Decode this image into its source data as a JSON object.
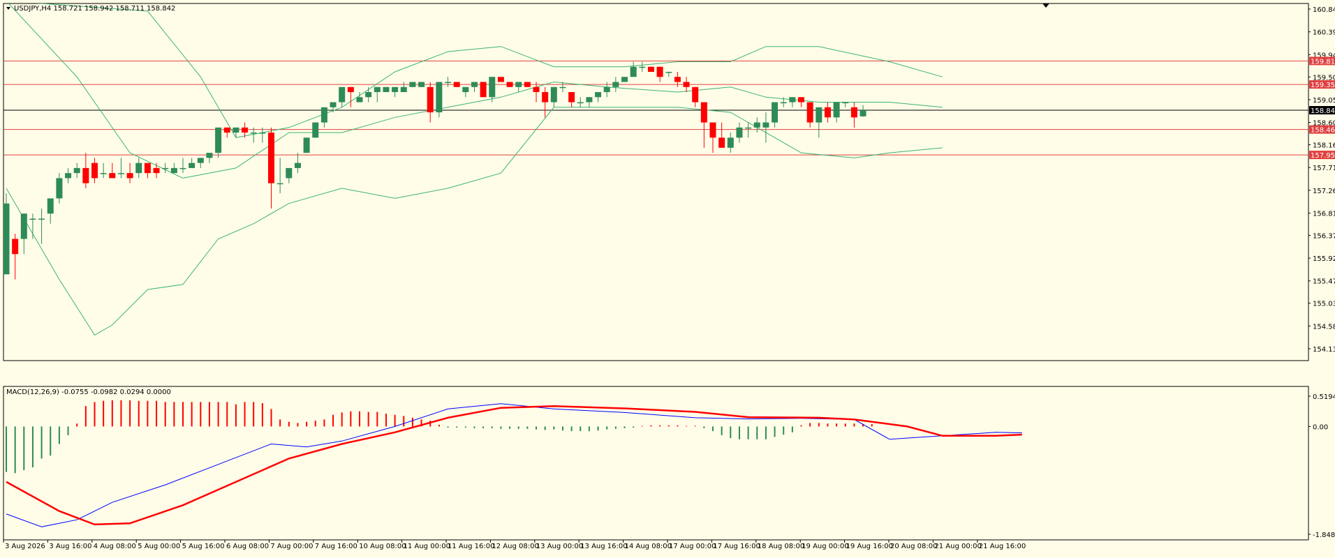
{
  "symbol_header": "USDJPY,H4  158.721 158.942 158.711 158.842",
  "macd_header": "MACD(12,26,9) -0.0755 -0.0982 0.0294 0.0000",
  "colors": {
    "background": "#fffde8",
    "bull": "#2e8b57",
    "bear": "#ff0000",
    "band": "#3cb371",
    "level_line": "#e04040",
    "current_price": "#000000",
    "macd_main": "#0000ff",
    "macd_signal": "#ff0000"
  },
  "price_axis": {
    "min": 154.13,
    "max": 160.84,
    "ticks": [
      "160.840",
      "160.390",
      "159.940",
      "159.500",
      "159.050",
      "158.600",
      "158.160",
      "157.710",
      "157.260",
      "156.810",
      "156.370",
      "155.920",
      "155.470",
      "155.030",
      "154.580",
      "154.130"
    ]
  },
  "level_labels": [
    {
      "value": 159.815,
      "label": "159.815"
    },
    {
      "value": 159.351,
      "label": "159.351"
    },
    {
      "value": 158.461,
      "label": "158.461"
    },
    {
      "value": 157.959,
      "label": "157.959"
    }
  ],
  "current_price": {
    "value": 158.842,
    "label": "158.842"
  },
  "macd_axis": {
    "min": -1.8482,
    "max": 0.5194,
    "ticks": [
      "0.5194",
      "0.00",
      "-1.8482"
    ]
  },
  "time_labels": [
    "3 Aug 2026",
    "3 Aug 16:00",
    "4 Aug 08:00",
    "5 Aug 00:00",
    "5 Aug 16:00",
    "6 Aug 08:00",
    "7 Aug 00:00",
    "7 Aug 16:00",
    "10 Aug 08:00",
    "11 Aug 00:00",
    "11 Aug 16:00",
    "12 Aug 08:00",
    "13 Aug 00:00",
    "13 Aug 16:00",
    "14 Aug 08:00",
    "17 Aug 00:00",
    "17 Aug 16:00",
    "18 Aug 08:00",
    "19 Aug 00:00",
    "19 Aug 16:00",
    "20 Aug 08:00",
    "21 Aug 00:00",
    "21 Aug 16:00"
  ],
  "chart_data": {
    "type": "candlestick",
    "symbol": "USDJPY",
    "timeframe": "H4",
    "candles": [
      {
        "o": 155.6,
        "h": 157.2,
        "l": 155.6,
        "c": 157.0
      },
      {
        "o": 156.3,
        "h": 156.4,
        "l": 155.5,
        "c": 156.0
      },
      {
        "o": 156.3,
        "h": 156.8,
        "l": 156.0,
        "c": 156.8
      },
      {
        "o": 156.7,
        "h": 156.8,
        "l": 156.3,
        "c": 156.7
      },
      {
        "o": 156.7,
        "h": 156.9,
        "l": 156.2,
        "c": 156.7
      },
      {
        "o": 156.8,
        "h": 157.1,
        "l": 156.6,
        "c": 157.1
      },
      {
        "o": 157.1,
        "h": 157.6,
        "l": 157.0,
        "c": 157.5
      },
      {
        "o": 157.5,
        "h": 157.7,
        "l": 157.4,
        "c": 157.6
      },
      {
        "o": 157.6,
        "h": 157.8,
        "l": 157.5,
        "c": 157.7
      },
      {
        "o": 157.7,
        "h": 158.0,
        "l": 157.3,
        "c": 157.4
      },
      {
        "o": 157.8,
        "h": 157.9,
        "l": 157.4,
        "c": 157.5
      },
      {
        "o": 157.6,
        "h": 157.8,
        "l": 157.5,
        "c": 157.6
      },
      {
        "o": 157.6,
        "h": 157.8,
        "l": 157.5,
        "c": 157.5
      },
      {
        "o": 157.6,
        "h": 157.9,
        "l": 157.5,
        "c": 157.6
      },
      {
        "o": 157.6,
        "h": 157.8,
        "l": 157.4,
        "c": 157.5
      },
      {
        "o": 157.6,
        "h": 157.9,
        "l": 157.5,
        "c": 157.8
      },
      {
        "o": 157.8,
        "h": 157.8,
        "l": 157.5,
        "c": 157.6
      },
      {
        "o": 157.7,
        "h": 157.8,
        "l": 157.5,
        "c": 157.6
      },
      {
        "o": 157.7,
        "h": 157.8,
        "l": 157.6,
        "c": 157.7
      },
      {
        "o": 157.6,
        "h": 157.8,
        "l": 157.6,
        "c": 157.7
      },
      {
        "o": 157.7,
        "h": 157.9,
        "l": 157.6,
        "c": 157.7
      },
      {
        "o": 157.7,
        "h": 157.9,
        "l": 157.7,
        "c": 157.8
      },
      {
        "o": 157.8,
        "h": 157.9,
        "l": 157.7,
        "c": 157.9
      },
      {
        "o": 157.9,
        "h": 158.0,
        "l": 157.8,
        "c": 158.0
      },
      {
        "o": 158.0,
        "h": 158.5,
        "l": 157.9,
        "c": 158.5
      },
      {
        "o": 158.5,
        "h": 158.5,
        "l": 158.3,
        "c": 158.4
      },
      {
        "o": 158.4,
        "h": 158.5,
        "l": 158.3,
        "c": 158.5
      },
      {
        "o": 158.5,
        "h": 158.6,
        "l": 158.3,
        "c": 158.4
      },
      {
        "o": 158.4,
        "h": 158.5,
        "l": 158.2,
        "c": 158.4
      },
      {
        "o": 158.4,
        "h": 158.5,
        "l": 158.2,
        "c": 158.4
      },
      {
        "o": 158.4,
        "h": 158.5,
        "l": 156.9,
        "c": 157.4
      },
      {
        "o": 157.4,
        "h": 157.9,
        "l": 157.2,
        "c": 157.4
      },
      {
        "o": 157.5,
        "h": 157.7,
        "l": 157.4,
        "c": 157.7
      },
      {
        "o": 157.7,
        "h": 158.0,
        "l": 157.6,
        "c": 157.8
      },
      {
        "o": 158.0,
        "h": 158.3,
        "l": 158.0,
        "c": 158.3
      },
      {
        "o": 158.3,
        "h": 158.6,
        "l": 158.3,
        "c": 158.6
      },
      {
        "o": 158.6,
        "h": 158.9,
        "l": 158.5,
        "c": 158.9
      },
      {
        "o": 158.9,
        "h": 159.0,
        "l": 158.8,
        "c": 159.0
      },
      {
        "o": 159.0,
        "h": 159.3,
        "l": 158.9,
        "c": 159.3
      },
      {
        "o": 159.3,
        "h": 159.3,
        "l": 158.9,
        "c": 159.2
      },
      {
        "o": 159.0,
        "h": 159.2,
        "l": 159.0,
        "c": 159.1
      },
      {
        "o": 159.1,
        "h": 159.3,
        "l": 159.0,
        "c": 159.2
      },
      {
        "o": 159.2,
        "h": 159.3,
        "l": 159.0,
        "c": 159.3
      },
      {
        "o": 159.2,
        "h": 159.3,
        "l": 159.2,
        "c": 159.3
      },
      {
        "o": 159.2,
        "h": 159.3,
        "l": 159.1,
        "c": 159.3
      },
      {
        "o": 159.2,
        "h": 159.4,
        "l": 159.2,
        "c": 159.3
      },
      {
        "o": 159.3,
        "h": 159.4,
        "l": 159.3,
        "c": 159.4
      },
      {
        "o": 159.3,
        "h": 159.4,
        "l": 159.3,
        "c": 159.4
      },
      {
        "o": 159.3,
        "h": 159.4,
        "l": 158.6,
        "c": 158.8
      },
      {
        "o": 158.8,
        "h": 159.4,
        "l": 158.7,
        "c": 159.4
      },
      {
        "o": 159.4,
        "h": 159.5,
        "l": 159.3,
        "c": 159.4
      },
      {
        "o": 159.4,
        "h": 159.4,
        "l": 159.3,
        "c": 159.3
      },
      {
        "o": 159.2,
        "h": 159.3,
        "l": 159.1,
        "c": 159.3
      },
      {
        "o": 159.3,
        "h": 159.4,
        "l": 159.2,
        "c": 159.4
      },
      {
        "o": 159.4,
        "h": 159.4,
        "l": 159.1,
        "c": 159.1
      },
      {
        "o": 159.1,
        "h": 159.5,
        "l": 159.0,
        "c": 159.5
      },
      {
        "o": 159.5,
        "h": 159.5,
        "l": 159.4,
        "c": 159.4
      },
      {
        "o": 159.4,
        "h": 159.4,
        "l": 159.3,
        "c": 159.3
      },
      {
        "o": 159.3,
        "h": 159.4,
        "l": 159.2,
        "c": 159.4
      },
      {
        "o": 159.4,
        "h": 159.4,
        "l": 159.3,
        "c": 159.3
      },
      {
        "o": 159.3,
        "h": 159.4,
        "l": 159.0,
        "c": 159.2
      },
      {
        "o": 159.2,
        "h": 159.3,
        "l": 158.7,
        "c": 159.0
      },
      {
        "o": 159.0,
        "h": 159.3,
        "l": 158.9,
        "c": 159.3
      },
      {
        "o": 159.3,
        "h": 159.4,
        "l": 159.2,
        "c": 159.3
      },
      {
        "o": 159.2,
        "h": 159.2,
        "l": 158.9,
        "c": 159.0
      },
      {
        "o": 159.0,
        "h": 159.1,
        "l": 158.9,
        "c": 159.0
      },
      {
        "o": 159.0,
        "h": 159.1,
        "l": 158.9,
        "c": 159.1
      },
      {
        "o": 159.1,
        "h": 159.2,
        "l": 159.0,
        "c": 159.2
      },
      {
        "o": 159.2,
        "h": 159.4,
        "l": 159.1,
        "c": 159.3
      },
      {
        "o": 159.3,
        "h": 159.5,
        "l": 159.2,
        "c": 159.4
      },
      {
        "o": 159.4,
        "h": 159.5,
        "l": 159.4,
        "c": 159.5
      },
      {
        "o": 159.5,
        "h": 159.8,
        "l": 159.5,
        "c": 159.7
      },
      {
        "o": 159.7,
        "h": 159.8,
        "l": 159.6,
        "c": 159.7
      },
      {
        "o": 159.7,
        "h": 159.7,
        "l": 159.6,
        "c": 159.6
      },
      {
        "o": 159.7,
        "h": 159.7,
        "l": 159.4,
        "c": 159.5
      },
      {
        "o": 159.6,
        "h": 159.6,
        "l": 159.5,
        "c": 159.6
      },
      {
        "o": 159.5,
        "h": 159.6,
        "l": 159.3,
        "c": 159.4
      },
      {
        "o": 159.4,
        "h": 159.5,
        "l": 159.2,
        "c": 159.3
      },
      {
        "o": 159.3,
        "h": 159.3,
        "l": 158.9,
        "c": 159.0
      },
      {
        "o": 159.0,
        "h": 159.0,
        "l": 158.1,
        "c": 158.6
      },
      {
        "o": 158.6,
        "h": 158.6,
        "l": 158.0,
        "c": 158.3
      },
      {
        "o": 158.3,
        "h": 158.6,
        "l": 158.1,
        "c": 158.1
      },
      {
        "o": 158.1,
        "h": 158.4,
        "l": 158.0,
        "c": 158.3
      },
      {
        "o": 158.3,
        "h": 158.6,
        "l": 158.2,
        "c": 158.5
      },
      {
        "o": 158.5,
        "h": 158.6,
        "l": 158.3,
        "c": 158.5
      },
      {
        "o": 158.5,
        "h": 158.7,
        "l": 158.4,
        "c": 158.6
      },
      {
        "o": 158.5,
        "h": 158.8,
        "l": 158.2,
        "c": 158.6
      },
      {
        "o": 158.6,
        "h": 159.0,
        "l": 158.5,
        "c": 159.0
      },
      {
        "o": 159.0,
        "h": 159.1,
        "l": 158.9,
        "c": 159.0
      },
      {
        "o": 159.0,
        "h": 159.1,
        "l": 158.9,
        "c": 159.1
      },
      {
        "o": 159.1,
        "h": 159.1,
        "l": 158.9,
        "c": 159.0
      },
      {
        "o": 159.0,
        "h": 159.0,
        "l": 158.5,
        "c": 158.6
      },
      {
        "o": 158.6,
        "h": 158.9,
        "l": 158.3,
        "c": 158.9
      },
      {
        "o": 158.9,
        "h": 159.0,
        "l": 158.6,
        "c": 158.7
      },
      {
        "o": 158.7,
        "h": 159.0,
        "l": 158.6,
        "c": 159.0
      },
      {
        "o": 159.0,
        "h": 159.0,
        "l": 158.9,
        "c": 159.0
      },
      {
        "o": 158.9,
        "h": 159.0,
        "l": 158.5,
        "c": 158.7
      },
      {
        "o": 158.721,
        "h": 158.942,
        "l": 158.711,
        "c": 158.842
      }
    ],
    "bollinger": {
      "upper": [
        [
          0,
          161.0
        ],
        [
          16,
          160.8
        ],
        [
          22,
          159.5
        ],
        [
          26,
          158.3
        ],
        [
          32,
          158.5
        ],
        [
          38,
          158.9
        ],
        [
          44,
          159.6
        ],
        [
          50,
          160.0
        ],
        [
          56,
          160.1
        ],
        [
          62,
          159.7
        ],
        [
          70,
          159.7
        ],
        [
          76,
          159.8
        ],
        [
          82,
          159.8
        ],
        [
          86,
          160.1
        ],
        [
          92,
          160.1
        ],
        [
          100,
          159.8
        ],
        [
          106,
          159.5
        ]
      ],
      "middle": [
        [
          0,
          161.0
        ],
        [
          8,
          159.5
        ],
        [
          14,
          158.0
        ],
        [
          20,
          157.5
        ],
        [
          26,
          157.7
        ],
        [
          32,
          158.4
        ],
        [
          38,
          158.4
        ],
        [
          44,
          158.7
        ],
        [
          50,
          158.9
        ],
        [
          56,
          159.1
        ],
        [
          62,
          159.4
        ],
        [
          68,
          159.3
        ],
        [
          76,
          159.2
        ],
        [
          82,
          159.3
        ],
        [
          86,
          159.1
        ],
        [
          92,
          159.0
        ],
        [
          100,
          159.0
        ],
        [
          106,
          158.9
        ]
      ],
      "lower": [
        [
          0,
          157.3
        ],
        [
          6,
          155.5
        ],
        [
          10,
          154.4
        ],
        [
          12,
          154.6
        ],
        [
          16,
          155.3
        ],
        [
          20,
          155.4
        ],
        [
          24,
          156.3
        ],
        [
          28,
          156.6
        ],
        [
          32,
          157.0
        ],
        [
          38,
          157.3
        ],
        [
          44,
          157.1
        ],
        [
          50,
          157.3
        ],
        [
          56,
          157.6
        ],
        [
          62,
          158.9
        ],
        [
          68,
          158.9
        ],
        [
          76,
          158.9
        ],
        [
          82,
          158.8
        ],
        [
          86,
          158.4
        ],
        [
          90,
          158.0
        ],
        [
          96,
          157.9
        ],
        [
          100,
          158.0
        ],
        [
          106,
          158.1
        ]
      ]
    },
    "macd": {
      "main": [
        [
          0,
          -1.5
        ],
        [
          4,
          -1.72
        ],
        [
          8,
          -1.6
        ],
        [
          12,
          -1.3
        ],
        [
          18,
          -1.0
        ],
        [
          24,
          -0.65
        ],
        [
          30,
          -0.3
        ],
        [
          34,
          -0.35
        ],
        [
          38,
          -0.25
        ],
        [
          44,
          0.0
        ],
        [
          50,
          0.3
        ],
        [
          56,
          0.39
        ],
        [
          62,
          0.3
        ],
        [
          70,
          0.24
        ],
        [
          78,
          0.15
        ],
        [
          84,
          0.13
        ],
        [
          90,
          0.14
        ],
        [
          96,
          0.12
        ],
        [
          100,
          -0.22
        ],
        [
          106,
          -0.16
        ],
        [
          112,
          -0.1
        ],
        [
          115,
          -0.11
        ]
      ],
      "signal": [
        [
          0,
          -0.95
        ],
        [
          6,
          -1.45
        ],
        [
          10,
          -1.68
        ],
        [
          14,
          -1.66
        ],
        [
          20,
          -1.35
        ],
        [
          26,
          -0.95
        ],
        [
          32,
          -0.55
        ],
        [
          38,
          -0.3
        ],
        [
          44,
          -0.1
        ],
        [
          50,
          0.15
        ],
        [
          56,
          0.32
        ],
        [
          62,
          0.35
        ],
        [
          70,
          0.31
        ],
        [
          78,
          0.25
        ],
        [
          84,
          0.16
        ],
        [
          92,
          0.15
        ],
        [
          96,
          0.12
        ],
        [
          102,
          0.0
        ],
        [
          106,
          -0.16
        ],
        [
          112,
          -0.16
        ],
        [
          115,
          -0.14
        ]
      ],
      "histogram": [
        -0.78,
        -0.8,
        -0.75,
        -0.7,
        -0.55,
        -0.5,
        -0.3,
        -0.15,
        0.05,
        0.35,
        0.42,
        0.44,
        0.45,
        0.45,
        0.45,
        0.44,
        0.44,
        0.44,
        0.42,
        0.42,
        0.42,
        0.42,
        0.42,
        0.42,
        0.42,
        0.42,
        0.38,
        0.42,
        0.42,
        0.4,
        0.3,
        0.12,
        0.08,
        0.06,
        0.08,
        0.1,
        0.12,
        0.2,
        0.24,
        0.26,
        0.26,
        0.25,
        0.25,
        0.22,
        0.2,
        0.18,
        0.15,
        0.12,
        0.1,
        0.03,
        -0.02,
        -0.02,
        -0.02,
        -0.03,
        -0.03,
        -0.03,
        -0.04,
        -0.04,
        -0.04,
        -0.04,
        -0.05,
        -0.06,
        -0.05,
        -0.07,
        -0.08,
        -0.08,
        -0.08,
        -0.07,
        -0.05,
        -0.04,
        -0.03,
        -0.02,
        0.01,
        0.02,
        0.02,
        0.02,
        0.02,
        0.01,
        0.0,
        -0.03,
        -0.08,
        -0.15,
        -0.2,
        -0.22,
        -0.22,
        -0.22,
        -0.22,
        -0.18,
        -0.14,
        -0.1,
        0.02,
        0.06,
        0.06,
        0.05,
        0.05,
        0.05,
        0.05,
        0.04,
        0.04
      ]
    }
  }
}
